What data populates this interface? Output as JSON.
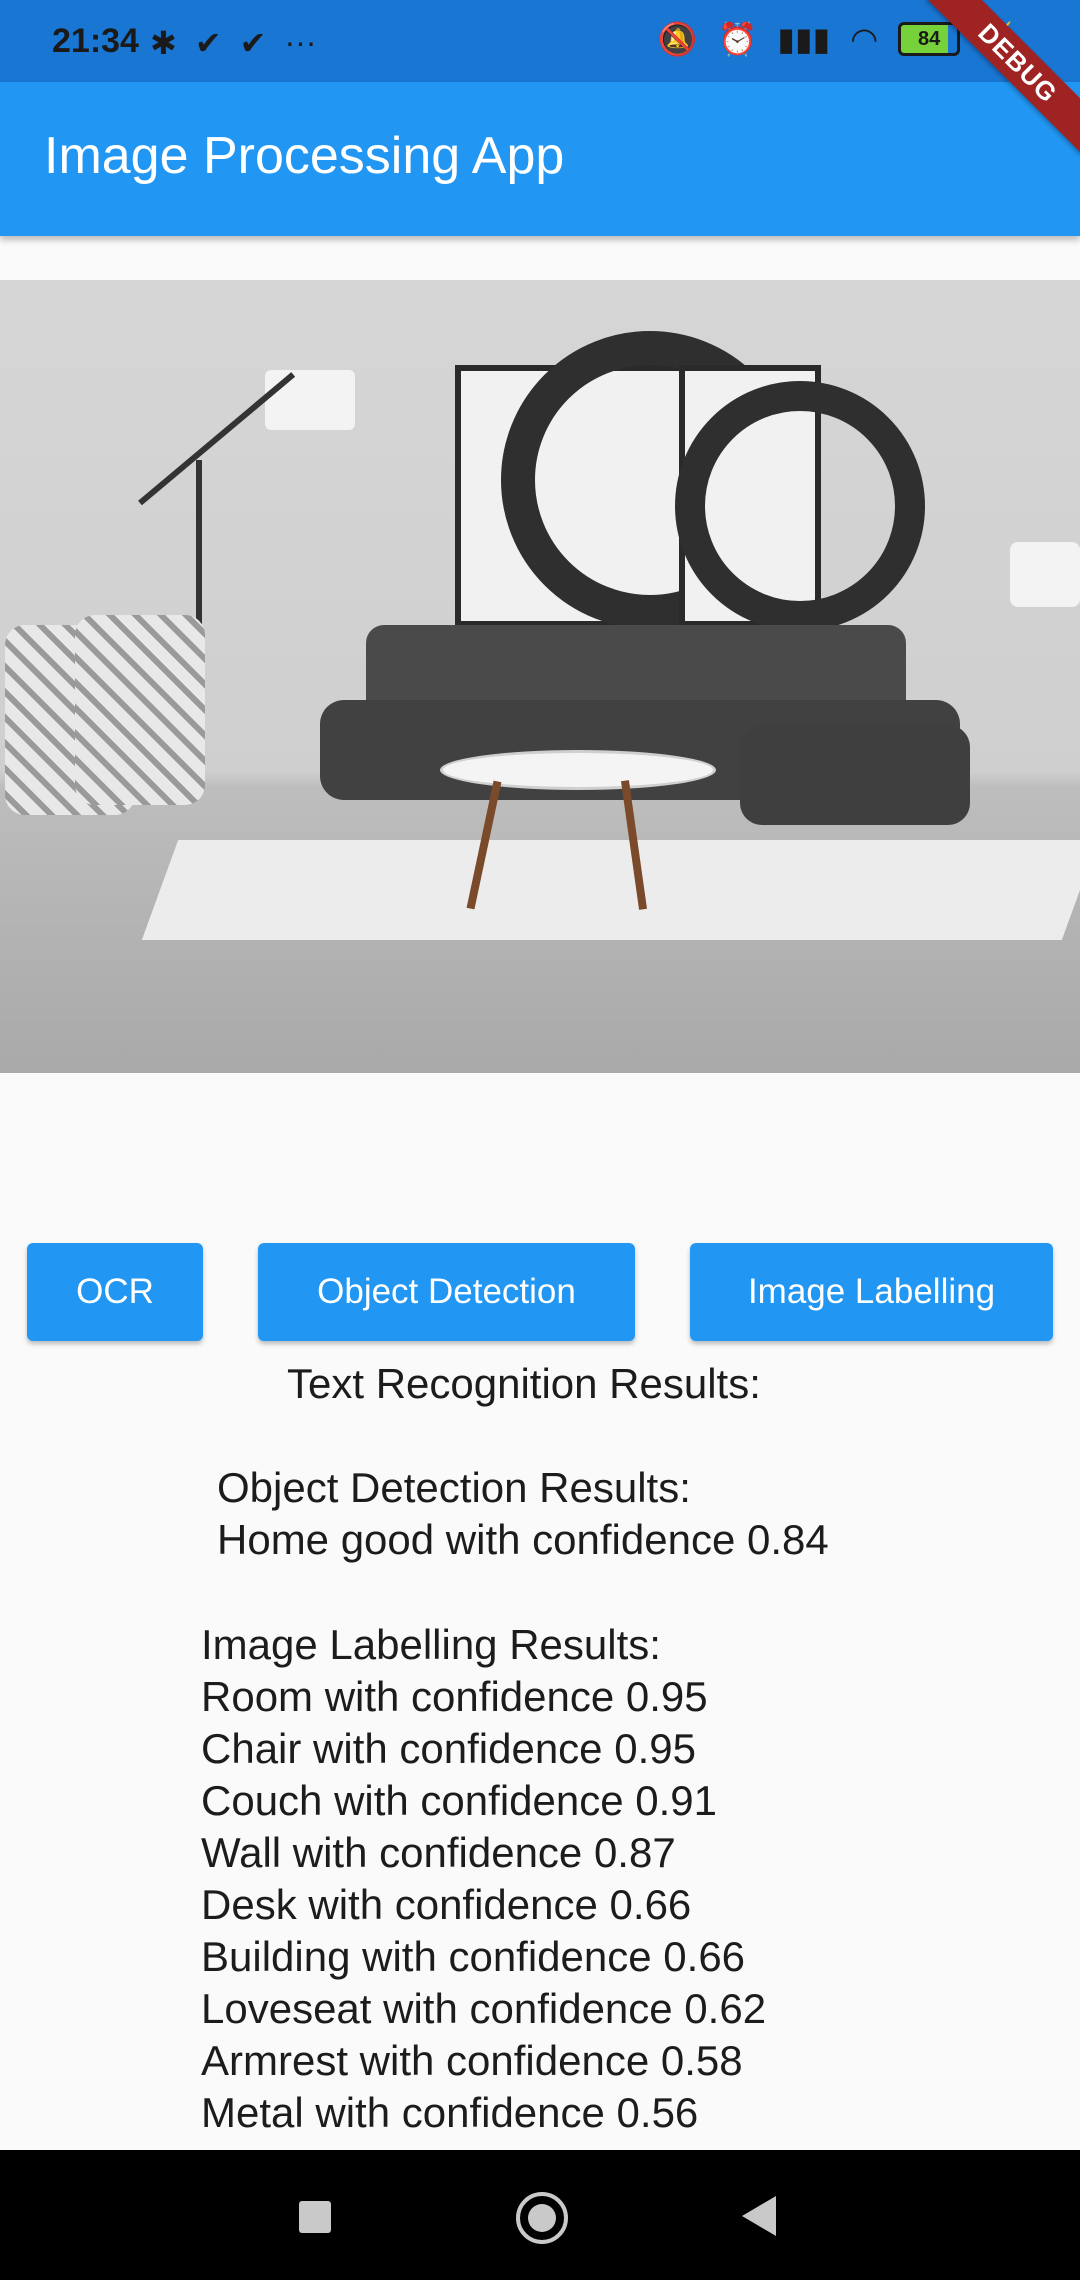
{
  "status_bar": {
    "time": "21:34",
    "left_icons": [
      "bluetooth-icon",
      "check-icon",
      "check-icon",
      "more-icon"
    ],
    "right_icons": [
      "bell-off-icon",
      "alarm-icon",
      "signal-icon",
      "wifi-icon",
      "battery-icon",
      "charging-icon"
    ],
    "battery_level": "84"
  },
  "app_bar": {
    "title": "Image Processing App",
    "debug_banner": "DEBUG"
  },
  "buttons": {
    "ocr": "OCR",
    "object_detection": "Object Detection",
    "image_labelling": "Image Labelling"
  },
  "results": {
    "text_recognition_header": "Text Recognition Results:",
    "object_detection_header": "Object Detection Results:",
    "object_detection_items": [
      "Home good with confidence 0.84"
    ],
    "image_labelling_header": "Image Labelling Results:",
    "image_labelling_items": [
      "Room with confidence 0.95",
      "Chair with confidence 0.95",
      "Couch with confidence 0.91",
      "Wall with confidence 0.87",
      "Desk with confidence 0.66",
      "Building with confidence 0.66",
      "Loveseat with confidence 0.62",
      "Armrest with confidence 0.58",
      "Metal with confidence 0.56"
    ]
  },
  "nav_bar": {
    "icons": [
      "recents-square-icon",
      "home-circle-icon",
      "back-triangle-icon"
    ]
  },
  "colors": {
    "primary": "#2196f3",
    "status_bar": "#1976d2",
    "debug_banner": "#a02323"
  }
}
